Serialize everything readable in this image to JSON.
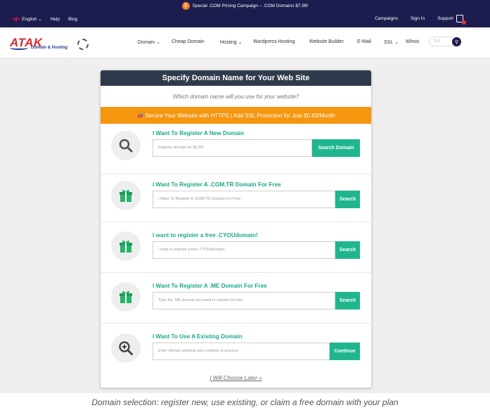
{
  "promo": {
    "text": "Special .COM Pricing Campaign – .COM Domains $7.99!"
  },
  "utility": {
    "language": "English",
    "help": "Help",
    "blog": "Blog",
    "campaigns": "Campaigns",
    "signin": "Sign In",
    "support": "Support"
  },
  "logo": {
    "brand": "ATAK",
    "tagline": "Domain & Hosting"
  },
  "nav": [
    "Domain",
    "Cheap Domain",
    "Hosting",
    "Wordpress Hosting",
    "Website Builder",
    "E-Mail",
    "SSL",
    "Whois"
  ],
  "tld": {
    "placeholder": "TLD"
  },
  "card": {
    "title": "Specify Domain Name for Your Web Site",
    "subtitle": "Which domain name will you use for your website?",
    "ssl": "Secure Your Website with HTTPS | Add SSL Protection for Just $0.83/Month",
    "rows": [
      {
        "icon": "search-icon",
        "title": "I Want To Register A New Domain",
        "placeholder": "Register domain for $0.99!",
        "button": "Search Domain"
      },
      {
        "icon": "gift-icon",
        "title": "I Want To Register A .COM.TR Domain For Free",
        "placeholder": "I Want To Register A .COM.TR Domain For Free",
        "button": "Search"
      },
      {
        "icon": "gift-icon",
        "title": "I want to register a free .CYOUdomain!",
        "placeholder": "I want to register a free .CYOUdomain!",
        "button": "Search"
      },
      {
        "icon": "gift-icon",
        "title": "I Want To Register A .ME Domain For Free",
        "placeholder": "Type the .ME domain you want to register for free",
        "button": "Search"
      },
      {
        "icon": "zoom-in-icon",
        "title": "I Want To Use A Existing Domain",
        "placeholder": "Enter domain address and continue to process.",
        "button": "Continue"
      }
    ],
    "later": "I Will Choose Later"
  },
  "caption": "Domain selection: register new, use existing, or claim a free domain with your plan",
  "colors": {
    "navy": "#1c1c4f",
    "accent_green": "#1fb68e",
    "ssl_orange": "#f5960f",
    "card_header": "#2f3b4c"
  }
}
